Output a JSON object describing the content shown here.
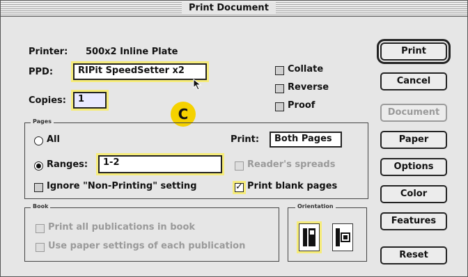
{
  "window": {
    "title": "Print Document"
  },
  "printer": {
    "label": "Printer:",
    "value": "500x2 Inline Plate"
  },
  "ppd": {
    "label": "PPD:",
    "value": "RIPit SpeedSetter x2"
  },
  "copies": {
    "label": "Copies:",
    "value": "1"
  },
  "options": {
    "collate": "Collate",
    "reverse": "Reverse",
    "proof": "Proof"
  },
  "pages": {
    "group_label": "Pages",
    "all_label": "All",
    "ranges_label": "Ranges:",
    "ranges_value": "1-2",
    "ignore_label": "Ignore \"Non-Printing\" setting",
    "print_label": "Print:",
    "print_value": "Both Pages",
    "readers_spreads_label": "Reader's spreads",
    "print_blank_label": "Print blank pages"
  },
  "book": {
    "group_label": "Book",
    "all_pubs_label": "Print all publications in book",
    "paper_settings_label": "Use paper settings of each publication"
  },
  "orientation": {
    "group_label": "Orientation"
  },
  "buttons": {
    "print": "Print",
    "cancel": "Cancel",
    "document": "Document",
    "paper": "Paper",
    "options": "Options",
    "color": "Color",
    "features": "Features",
    "reset": "Reset"
  },
  "annotation": {
    "badge": "C"
  },
  "state": {
    "pages_selected": "ranges",
    "print_blank_pages": true,
    "collate": false,
    "reverse": false,
    "proof": false,
    "orientation": "portrait"
  }
}
